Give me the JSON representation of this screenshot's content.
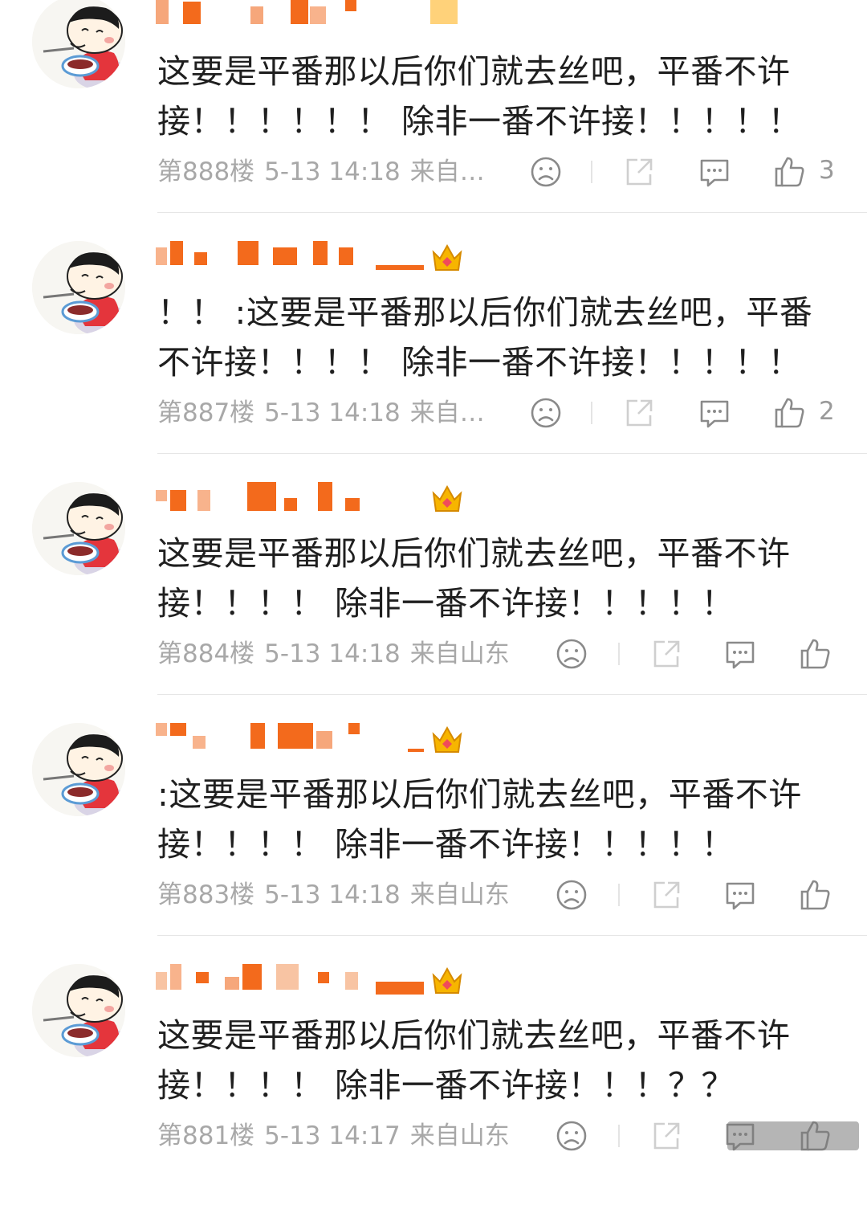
{
  "comments": [
    {
      "text": "这要是平番那以后你们就去丝吧，平番不许接！！！！！！ 除非一番不许接！！！！！",
      "floor": "第888楼",
      "datetime": "5-13 14:18",
      "source": "来自…",
      "likes": "3",
      "has_crown": false
    },
    {
      "text": "！！ :这要是平番那以后你们就去丝吧，平番不许接！！！！ 除非一番不许接！！！！！",
      "floor": "第887楼",
      "datetime": "5-13 14:18",
      "source": "来自…",
      "likes": "2",
      "has_crown": true
    },
    {
      "text": "这要是平番那以后你们就去丝吧，平番不许接！！！！ 除非一番不许接！！！！！",
      "floor": "第884楼",
      "datetime": "5-13 14:18",
      "source": "来自山东",
      "likes": "",
      "has_crown": true
    },
    {
      "text": ":这要是平番那以后你们就去丝吧，平番不许接！！！！ 除非一番不许接！！！！！",
      "floor": "第883楼",
      "datetime": "5-13 14:18",
      "source": "来自山东",
      "likes": "",
      "has_crown": true
    },
    {
      "text": "这要是平番那以后你们就去丝吧，平番不许接！！！！ 除非一番不许接！！！？？",
      "floor": "第881楼",
      "datetime": "5-13 14:17",
      "source": "来自山东",
      "likes": "",
      "has_crown": true
    }
  ],
  "icons": {
    "dislike": "sad-face-icon",
    "share": "share-icon",
    "reply": "comment-icon",
    "like": "thumbs-up-icon",
    "crown": "crown-badge-icon"
  },
  "colors": {
    "username_mosaic": "#f36a1c",
    "text": "#1f1f1f",
    "meta": "#a8a8a8"
  }
}
